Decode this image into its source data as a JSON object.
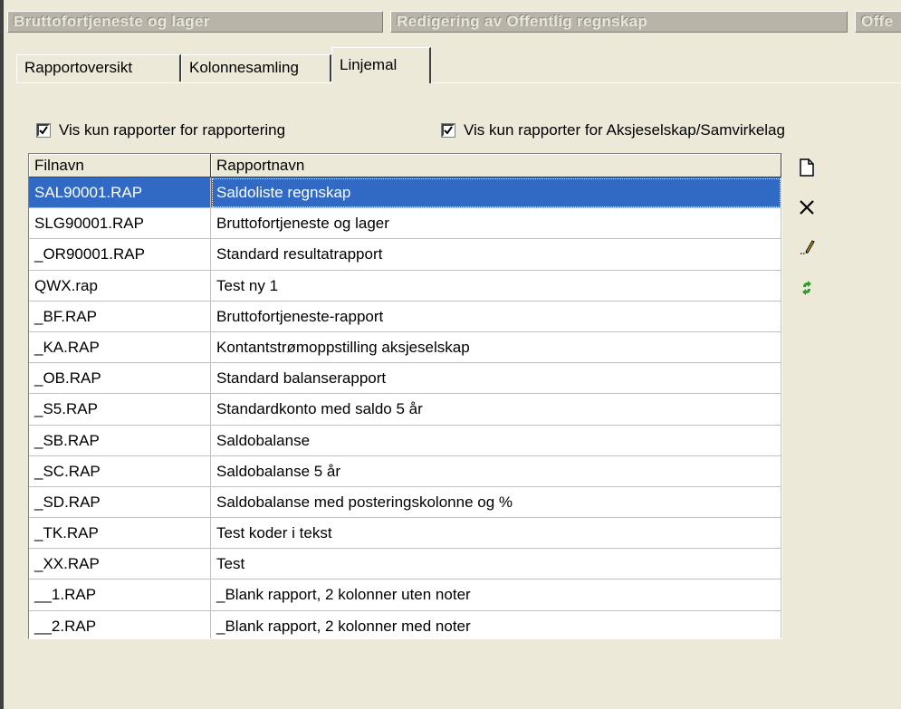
{
  "window_tabs": [
    {
      "label": "Bruttofortjeneste og lager"
    },
    {
      "label": "Redigering av Offentlig regnskap"
    },
    {
      "label": "Offe"
    }
  ],
  "tabs": [
    {
      "label": "Rapportoversikt"
    },
    {
      "label": "Kolonnesamling"
    },
    {
      "label": "Linjemal",
      "active": true
    }
  ],
  "checkboxes": {
    "report_only": {
      "label": "Vis kun rapporter for rapportering",
      "checked": true
    },
    "company_type": {
      "label": "Vis kun rapporter for Aksjeselskap/Samvirkelag",
      "checked": true
    }
  },
  "table": {
    "columns": [
      "Filnavn",
      "Rapportnavn"
    ],
    "rows": [
      [
        "SAL90001.RAP",
        "Saldoliste regnskap"
      ],
      [
        "SLG90001.RAP",
        "Bruttofortjeneste og lager"
      ],
      [
        "_OR90001.RAP",
        "Standard resultatrapport"
      ],
      [
        "QWX.rap",
        "Test ny 1"
      ],
      [
        "_BF.RAP",
        "Bruttofortjeneste-rapport"
      ],
      [
        "_KA.RAP",
        "Kontantstrømoppstilling aksjeselskap"
      ],
      [
        "_OB.RAP",
        "Standard balanserapport"
      ],
      [
        "_S5.RAP",
        "Standardkonto med saldo 5 år"
      ],
      [
        "_SB.RAP",
        "Saldobalanse"
      ],
      [
        "_SC.RAP",
        "Saldobalanse 5 år"
      ],
      [
        "_SD.RAP",
        "Saldobalanse med posteringskolonne og %"
      ],
      [
        "_TK.RAP",
        "Test koder i tekst"
      ],
      [
        "_XX.RAP",
        "Test"
      ],
      [
        "__1.RAP",
        "_Blank rapport, 2 kolonner uten noter"
      ],
      [
        "__2.RAP",
        "_Blank rapport, 2 kolonner med noter"
      ]
    ],
    "selected_row": 0
  },
  "toolbar": {
    "icons": [
      "new-document-icon",
      "delete-icon",
      "edit-pencil-icon",
      "refresh-icon"
    ]
  },
  "colors": {
    "selection": "#316ac5",
    "face": "#ece9d8",
    "refresh_green": "#2e9a2e"
  }
}
